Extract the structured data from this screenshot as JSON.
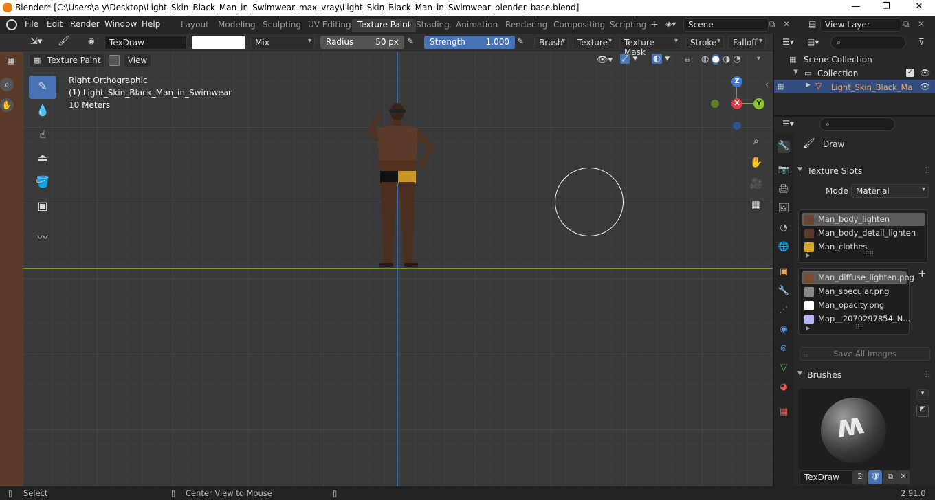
{
  "window": {
    "title": "Blender* [C:\\Users\\a y\\Desktop\\Light_Skin_Black_Man_in_Swimwear_max_vray\\Light_Skin_Black_Man_in_Swimwear_blender_base.blend]",
    "minimize": "—",
    "maximize": "❐",
    "close": "✕"
  },
  "menus": [
    "File",
    "Edit",
    "Render",
    "Window",
    "Help"
  ],
  "workspaces": [
    "Layout",
    "Modeling",
    "Sculpting",
    "UV Editing",
    "Texture Paint",
    "Shading",
    "Animation",
    "Rendering",
    "Compositing",
    "Scripting"
  ],
  "scene": {
    "name": "Scene",
    "view_layer": "View Layer"
  },
  "toolbar": {
    "brush_name": "TexDraw",
    "blend_mode": "Mix",
    "radius_label": "Radius",
    "radius_value": "50 px",
    "strength_label": "Strength",
    "strength_value": "1.000",
    "brush_menu": "Brush",
    "texture_menu": "Texture",
    "texture_mask_menu": "Texture Mask",
    "stroke_menu": "Stroke",
    "falloff_menu": "Falloff"
  },
  "viewport_header": {
    "mode": "Texture Paint",
    "view": "View"
  },
  "viewport": {
    "view_name": "Right Orthographic",
    "object_info": "(1) Light_Skin_Black_Man_in_Swimwear",
    "scale": "10 Meters",
    "axis_x": "X",
    "axis_y": "Y",
    "axis_z": "Z"
  },
  "outliner": {
    "scene_collection": "Scene Collection",
    "collection": "Collection",
    "object": "Light_Skin_Black_Ma"
  },
  "properties": {
    "tool_name": "Draw",
    "texture_slots_title": "Texture Slots",
    "mode_label": "Mode",
    "mode_value": "Material",
    "materials": [
      {
        "name": "Man_body_lighten",
        "color": "#6b4530"
      },
      {
        "name": "Man_body_detail_lighten",
        "color": "#5a3a28"
      },
      {
        "name": "Man_clothes",
        "color": "#d4a62a"
      }
    ],
    "images": [
      {
        "name": "Man_diffuse_lighten.png",
        "color": "#7a4c33"
      },
      {
        "name": "Man_specular.png",
        "color": "#888888"
      },
      {
        "name": "Man_opacity.png",
        "color": "#ffffff"
      },
      {
        "name": "Map__2070297854_N...",
        "color": "#b4b4f0"
      }
    ],
    "save_all_images": "Save All Images",
    "brushes_title": "Brushes",
    "brush_slot_name": "TexDraw",
    "brush_users": "2"
  },
  "statusbar": {
    "select": "Select",
    "center_view": "Center View to Mouse",
    "version": "2.91.0"
  }
}
